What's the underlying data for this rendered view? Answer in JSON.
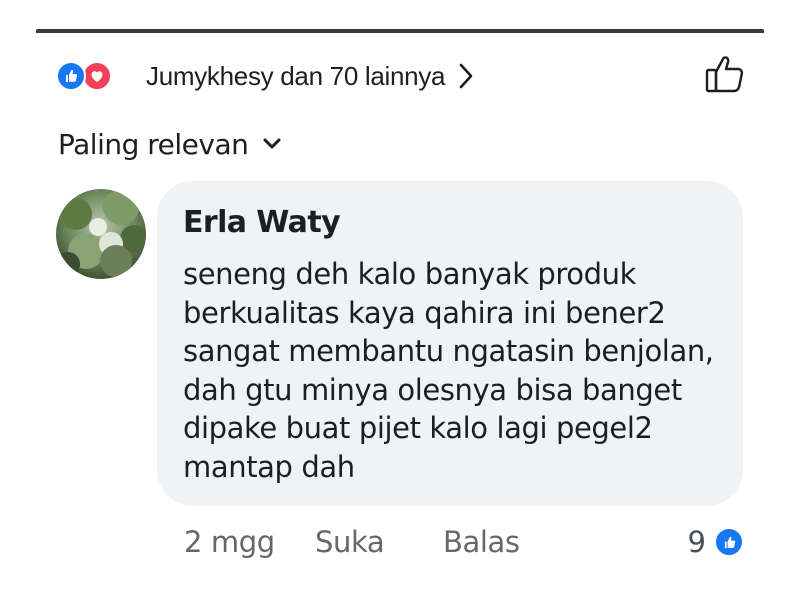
{
  "reactions": {
    "summary": "Jumykhesy dan 70 lainnya",
    "icons": [
      "like-icon",
      "love-icon"
    ],
    "like_color": "#1877f2",
    "love_color": "#f33e58"
  },
  "sort": {
    "label": "Paling relevan"
  },
  "comment": {
    "author": "Erla Waty",
    "lines": [
      "seneng deh kalo banyak produk",
      "berkualitas kaya qahira ini bener2",
      "sangat membantu ngatasin benjolan,",
      "dah gtu minya olesnya bisa banget",
      "dipake buat pijet kalo lagi pegel2",
      "mantap dah"
    ],
    "time": "2 mgg",
    "like_label": "Suka",
    "reply_label": "Balas",
    "reaction_count": "9"
  }
}
